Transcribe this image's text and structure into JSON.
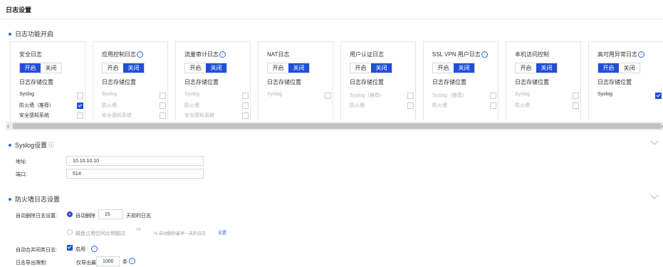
{
  "page_title": "日志设置",
  "sections": {
    "log_enable": "日志功能开启",
    "syslog": "Syslog设置",
    "firewall": "防火墙日志设置"
  },
  "toggle": {
    "on": "开启",
    "off": "关闭"
  },
  "store_label": "日志存储位置",
  "cards": [
    {
      "name": "安全日志",
      "info": false,
      "state": "on",
      "options": [
        {
          "label": "Syslog",
          "checked": false,
          "dim": false
        },
        {
          "label": "防火墙（推荐）",
          "checked": true,
          "dim": false
        },
        {
          "label": "安全感知系统",
          "checked": false,
          "dim": false
        }
      ]
    },
    {
      "name": "应用控制日志",
      "info": true,
      "state": "off",
      "options": [
        {
          "label": "Syslog",
          "checked": false,
          "dim": true
        },
        {
          "label": "防火墙",
          "checked": false,
          "dim": true
        },
        {
          "label": "安全感知系统",
          "checked": false,
          "dim": true
        }
      ]
    },
    {
      "name": "流量审计日志",
      "info": true,
      "state": "off",
      "options": [
        {
          "label": "Syslog",
          "checked": false,
          "dim": true
        },
        {
          "label": "防火墙",
          "checked": false,
          "dim": true
        },
        {
          "label": "安全感知系统",
          "checked": false,
          "dim": true
        }
      ]
    },
    {
      "name": "NAT日志",
      "info": false,
      "state": "off",
      "options": [
        {
          "label": "Syslog",
          "checked": false,
          "dim": true
        }
      ]
    },
    {
      "name": "用户认证日志",
      "info": false,
      "state": "off",
      "options": [
        {
          "label": "Syslog（推荐）",
          "checked": false,
          "dim": true
        },
        {
          "label": "防火墙",
          "checked": false,
          "dim": true
        }
      ]
    },
    {
      "name": "SSL VPN 用户日志",
      "info": true,
      "state": "off",
      "options": [
        {
          "label": "Syslog（推荐）",
          "checked": false,
          "dim": true
        },
        {
          "label": "防火墙",
          "checked": false,
          "dim": true
        }
      ]
    },
    {
      "name": "本机访问控制",
      "info": false,
      "state": "off",
      "options": [
        {
          "label": "Syslog",
          "checked": false,
          "dim": true
        },
        {
          "label": "防火墙",
          "checked": false,
          "dim": true
        }
      ]
    },
    {
      "name": "高可用异常日志",
      "info": true,
      "state": "on",
      "options": [
        {
          "label": "Syslog",
          "checked": true,
          "dim": false
        }
      ]
    }
  ],
  "syslog": {
    "address_label": "地址:",
    "address_value": "10.10.10.10",
    "port_label": "端口:",
    "port_value": "514"
  },
  "firewall": {
    "auto_delete_label": "自动删除日志设置:",
    "auto_delete_option": "自动删除",
    "days_value": "15",
    "days_suffix": "天前的日志",
    "disk_option": "磁盘占用空间比例超过",
    "disk_suffix": "% 自动删除最早一天的日志",
    "disk_link": "设置",
    "merge_label": "自动合并同类日志:",
    "merge_option": "启用",
    "export_label": "日志导出限制:",
    "export_prefix": "仅导出最近",
    "export_value": "1000",
    "export_suffix": "条"
  },
  "colors": {
    "accent": "#1f4fd8",
    "info": "#2f6bd8"
  }
}
